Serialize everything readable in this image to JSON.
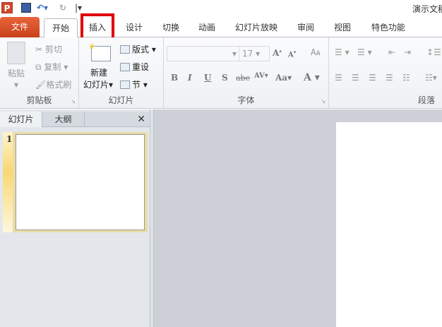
{
  "window": {
    "title": "演示文稿"
  },
  "quick_access": {
    "app_icon": "P",
    "icons": [
      "save-icon",
      "undo-icon",
      "redo-icon",
      "customize-icon"
    ]
  },
  "tabs": [
    {
      "label": "文件"
    },
    {
      "label": "开始"
    },
    {
      "label": "插入"
    },
    {
      "label": "设计"
    },
    {
      "label": "切换"
    },
    {
      "label": "动画"
    },
    {
      "label": "幻灯片放映"
    },
    {
      "label": "审阅"
    },
    {
      "label": "视图"
    },
    {
      "label": "特色功能"
    }
  ],
  "highlight_color": "#e00000",
  "ribbon": {
    "clipboard": {
      "label": "剪贴板",
      "paste": "粘贴",
      "cut": "剪切",
      "copy": "复制",
      "format_painter": "格式刷"
    },
    "slides": {
      "label": "幻灯片",
      "new_slide_1": "新建",
      "new_slide_2": "幻灯片",
      "layout": "版式",
      "reset": "重设",
      "section": "节"
    },
    "font": {
      "label": "字体",
      "font_size": "17",
      "bold": "B",
      "italic": "I",
      "underline": "U",
      "shadow": "S",
      "strike": "abe",
      "spacing": "AV",
      "case": "Aa",
      "color": "A"
    },
    "paragraph": {
      "label": "段落"
    }
  },
  "left_panel": {
    "tab_slides": "幻灯片",
    "tab_outline": "大纲",
    "close": "✕",
    "slide_number": "1"
  }
}
